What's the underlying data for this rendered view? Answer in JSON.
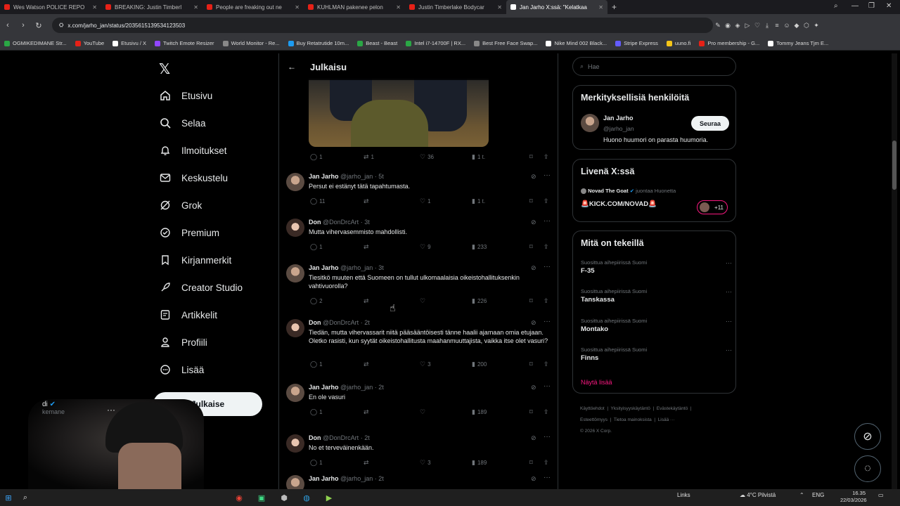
{
  "browser": {
    "tabs": [
      {
        "title": "Wes Watson POLICE REPO",
        "fav_color": "#e62117",
        "active": false
      },
      {
        "title": "BREAKING: Justin Timberl",
        "fav_color": "#e62117",
        "active": false
      },
      {
        "title": "People are freaking out ne",
        "fav_color": "#e62117",
        "active": false
      },
      {
        "title": "KUHLMAN pakenee pelon",
        "fav_color": "#e62117",
        "active": false
      },
      {
        "title": "Justin Timberlake Bodycar",
        "fav_color": "#e62117",
        "active": false
      },
      {
        "title": "Jan Jarho X:ssä: \"Kelatkaa",
        "fav_color": "#ffffff",
        "active": true
      }
    ],
    "url": "x.com/jarho_jan/status/2035615139534123503",
    "bookmarks": [
      {
        "label": "OGMIKEDIMANE Str...",
        "color": "#2aa745"
      },
      {
        "label": "YouTube",
        "color": "#e62117"
      },
      {
        "label": "Etusivu / X",
        "color": "#ffffff"
      },
      {
        "label": "Twitch Emote Resizer",
        "color": "#9146ff"
      },
      {
        "label": "World Monitor - Re...",
        "color": "#888888"
      },
      {
        "label": "Buy Retatrutide 10m...",
        "color": "#1d9bf0"
      },
      {
        "label": "Beast - Beast",
        "color": "#2aa745"
      },
      {
        "label": "Intel i7-14700F | RX...",
        "color": "#2aa745"
      },
      {
        "label": "Best Free Face Swap...",
        "color": "#888888"
      },
      {
        "label": "Nike Mind 002 Black...",
        "color": "#ffffff"
      },
      {
        "label": "Stripe Express",
        "color": "#635bff"
      },
      {
        "label": "uuno.fi",
        "color": "#f5c518"
      },
      {
        "label": "Pro membership - G...",
        "color": "#e62117"
      },
      {
        "label": "Tommy Jeans Tjm E...",
        "color": "#ffffff"
      }
    ]
  },
  "nav": {
    "items": [
      {
        "label": "Etusivu",
        "icon": "home-icon"
      },
      {
        "label": "Selaa",
        "icon": "search-icon"
      },
      {
        "label": "Ilmoitukset",
        "icon": "bell-icon"
      },
      {
        "label": "Keskustelu",
        "icon": "mail-icon"
      },
      {
        "label": "Grok",
        "icon": "grok-icon"
      },
      {
        "label": "Premium",
        "icon": "premium-icon"
      },
      {
        "label": "Kirjanmerkit",
        "icon": "bookmark-icon"
      },
      {
        "label": "Creator Studio",
        "icon": "rocket-icon"
      },
      {
        "label": "Artikkelit",
        "icon": "article-icon"
      },
      {
        "label": "Profiili",
        "icon": "person-icon"
      },
      {
        "label": "Lisää",
        "icon": "more-circle-icon"
      }
    ],
    "post_label": "Julkaise",
    "account_name": "di",
    "account_handle": "kemane"
  },
  "center": {
    "title": "Julkaisu",
    "main_actions": {
      "replies": "1",
      "reposts": "1",
      "likes": "36",
      "views": "1 t."
    },
    "replies": [
      {
        "name": "Jan Jarho",
        "handle": "@jarho_jan",
        "time": "5t",
        "text": "Persut ei estänyt tätä tapahtumasta.",
        "avatar": "jan",
        "replies": "11",
        "reposts": "",
        "likes": "1",
        "views": "1 t."
      },
      {
        "name": "Don",
        "handle": "@DonDrcArt",
        "time": "3t",
        "text": "Mutta vihervasemmisto mahdollisti.",
        "avatar": "don",
        "replies": "1",
        "reposts": "",
        "likes": "9",
        "views": "233"
      },
      {
        "name": "Jan Jarho",
        "handle": "@jarho_jan",
        "time": "3t",
        "text": "Tiesitkö muuten että Suomeen on tullut ulkomaalaisia oikeistohallituksenkin vahtivuorolla?",
        "avatar": "jan",
        "replies": "2",
        "reposts": "",
        "likes": "",
        "views": "226"
      },
      {
        "name": "Don",
        "handle": "@DonDrcArt",
        "time": "2t",
        "text": "Tiedän, mutta vihervassarit niitä pääsääntöisesti tänne haalii ajamaan omia etujaan. Oletko rasisti, kun syytät oikeistohallitusta maahanmuuttajista, vaikka itse olet vasuri?",
        "avatar": "don",
        "replies": "1",
        "reposts": "",
        "likes": "3",
        "views": "200"
      },
      {
        "name": "Jan Jarho",
        "handle": "@jarho_jan",
        "time": "2t",
        "text": "En ole vasuri",
        "avatar": "jan",
        "replies": "1",
        "reposts": "",
        "likes": "",
        "views": "189"
      },
      {
        "name": "Don",
        "handle": "@DonDrcArt",
        "time": "2t",
        "text": "No et terveväinenkään.",
        "avatar": "don",
        "replies": "1",
        "reposts": "",
        "likes": "3",
        "views": "189"
      },
      {
        "name": "Jan Jarho",
        "handle": "@jarho_jan",
        "time": "2t",
        "text": "",
        "avatar": "jan",
        "replies": "",
        "reposts": "",
        "likes": "",
        "views": ""
      }
    ]
  },
  "sidebar": {
    "search_placeholder": "Hae",
    "people_title": "Merkityksellisiä henkilöitä",
    "person_name": "Jan Jarho",
    "person_handle": "@jarho_jan",
    "person_bio": "Huono huumori on parasta huumoria.",
    "follow_label": "Seuraa",
    "live_title": "Livenä X:ssä",
    "live_host": "Novad The Goat",
    "live_host_suffix": "juontaa Huonetta",
    "live_title_text": "🚨KICK.COM/NOVAD🚨",
    "live_count": "+11",
    "trends_title": "Mitä on tekeillä",
    "trends": [
      {
        "category": "Suosittua aihepiirissä Suomi",
        "title": "F-35"
      },
      {
        "category": "Suosittua aihepiirissä Suomi",
        "title": "Tanskassa"
      },
      {
        "category": "Suosittua aihepiirissä Suomi",
        "title": "Montako"
      },
      {
        "category": "Suosittua aihepiirissä Suomi",
        "title": "Finns"
      }
    ],
    "show_more": "Näytä lisää",
    "footer_links": [
      "Käyttöehdot",
      "Yksityisyyskäytäntö",
      "Evästekäytäntö",
      "Esteettömyys",
      "Tietoa mainoksista",
      "Lisää ···"
    ],
    "copyright": "© 2026 X Corp."
  },
  "taskbar": {
    "links": "Links",
    "weather": "4°C Pilvistä",
    "lang": "ENG",
    "time": "16.35",
    "date": "22/03/2026"
  },
  "colors": {
    "accent_pink": "#f91880",
    "bg": "#000000",
    "muted": "#71767b"
  }
}
